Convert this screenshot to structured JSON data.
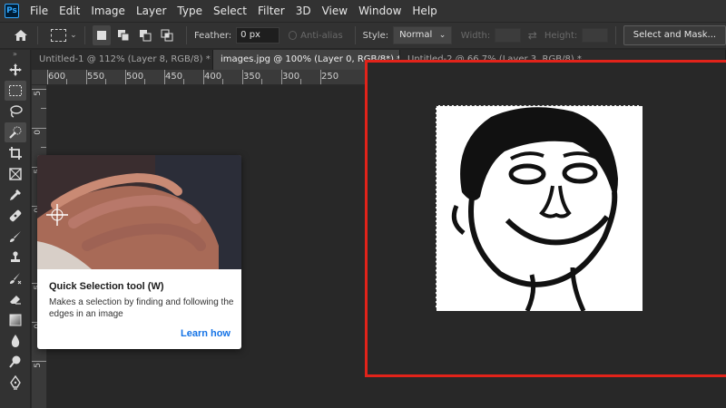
{
  "app": {
    "logo_text": "Ps"
  },
  "menu": [
    "File",
    "Edit",
    "Image",
    "Layer",
    "Type",
    "Select",
    "Filter",
    "3D",
    "View",
    "Window",
    "Help"
  ],
  "options": {
    "feather_label": "Feather:",
    "feather_value": "0 px",
    "antialias_label": "Anti-alias",
    "style_label": "Style:",
    "style_value": "Normal",
    "width_label": "Width:",
    "height_label": "Height:",
    "mask_button": "Select and Mask..."
  },
  "tabs": [
    {
      "label": "Untitled-1 @ 112% (Layer 8, RGB/8) *",
      "active": false
    },
    {
      "label": "images.jpg @ 100% (Layer 0, RGB/8*) *",
      "active": true
    },
    {
      "label": "Untitled-2 @ 66.7% (Layer 3, RGB/8) *",
      "active": false
    }
  ],
  "ruler": {
    "top_labels": [
      "600",
      "550",
      "500",
      "450",
      "400",
      "350",
      "300",
      "250"
    ],
    "left_labels": [
      "5",
      "0",
      "5",
      "0",
      "5",
      "0",
      "5"
    ]
  },
  "tooltip": {
    "title": "Quick Selection tool (W)",
    "description": "Makes a selection by finding and following the edges in an image",
    "link": "Learn how"
  },
  "colors": {
    "accent_link": "#1473e6",
    "highlight": "#e2231a",
    "ps_logo": "#31a8ff"
  },
  "tools": [
    "move-icon",
    "rectangular-marquee-icon",
    "lasso-icon",
    "quick-selection-icon",
    "crop-icon",
    "frame-icon",
    "eyedropper-icon",
    "healing-brush-icon",
    "brush-icon",
    "clone-stamp-icon",
    "history-brush-icon",
    "eraser-icon",
    "gradient-icon",
    "blur-icon",
    "dodge-icon",
    "pen-icon"
  ]
}
